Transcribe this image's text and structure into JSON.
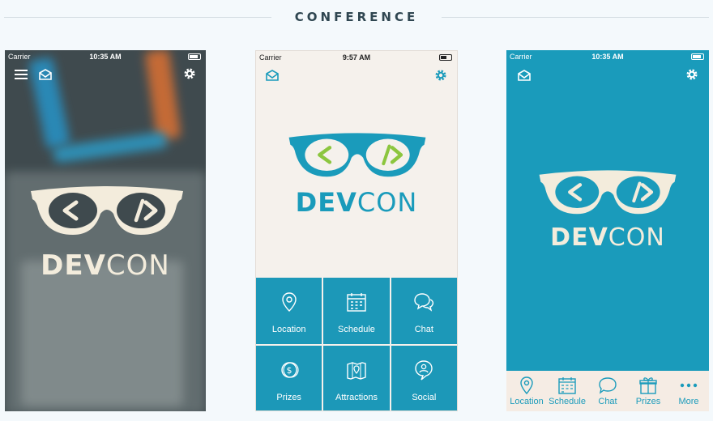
{
  "header": {
    "title": "CONFERENCE"
  },
  "colors": {
    "teal": "#1a9bbb",
    "green": "#8cc63f",
    "cream": "#f5f1ec",
    "logo_light": "#f3ecdc"
  },
  "phones": [
    {
      "status": {
        "carrier": "Carrier",
        "time": "10:35 AM"
      },
      "top_icons": [
        "menu-icon",
        "mail-icon",
        "gear-icon"
      ],
      "logo": {
        "dev": "DEV",
        "con": "CON"
      }
    },
    {
      "status": {
        "carrier": "Carrier",
        "time": "9:57 AM"
      },
      "top_icons": [
        "mail-icon",
        "gear-icon"
      ],
      "logo": {
        "dev": "DEV",
        "con": "CON"
      },
      "menu": [
        {
          "label": "Location",
          "icon": "location-pin-icon"
        },
        {
          "label": "Schedule",
          "icon": "calendar-icon"
        },
        {
          "label": "Chat",
          "icon": "chat-bubbles-icon"
        },
        {
          "label": "Prizes",
          "icon": "coin-icon"
        },
        {
          "label": "Attractions",
          "icon": "map-icon"
        },
        {
          "label": "Social",
          "icon": "social-user-icon"
        }
      ]
    },
    {
      "status": {
        "carrier": "Carrier",
        "time": "10:35 AM"
      },
      "top_icons": [
        "mail-icon",
        "gear-icon"
      ],
      "logo": {
        "dev": "DEV",
        "con": "CON"
      },
      "tabs": [
        {
          "label": "Location",
          "icon": "location-pin-icon"
        },
        {
          "label": "Schedule",
          "icon": "calendar-icon"
        },
        {
          "label": "Chat",
          "icon": "chat-bubble-icon"
        },
        {
          "label": "Prizes",
          "icon": "gift-icon"
        },
        {
          "label": "More",
          "icon": "more-dots-icon"
        }
      ]
    }
  ]
}
